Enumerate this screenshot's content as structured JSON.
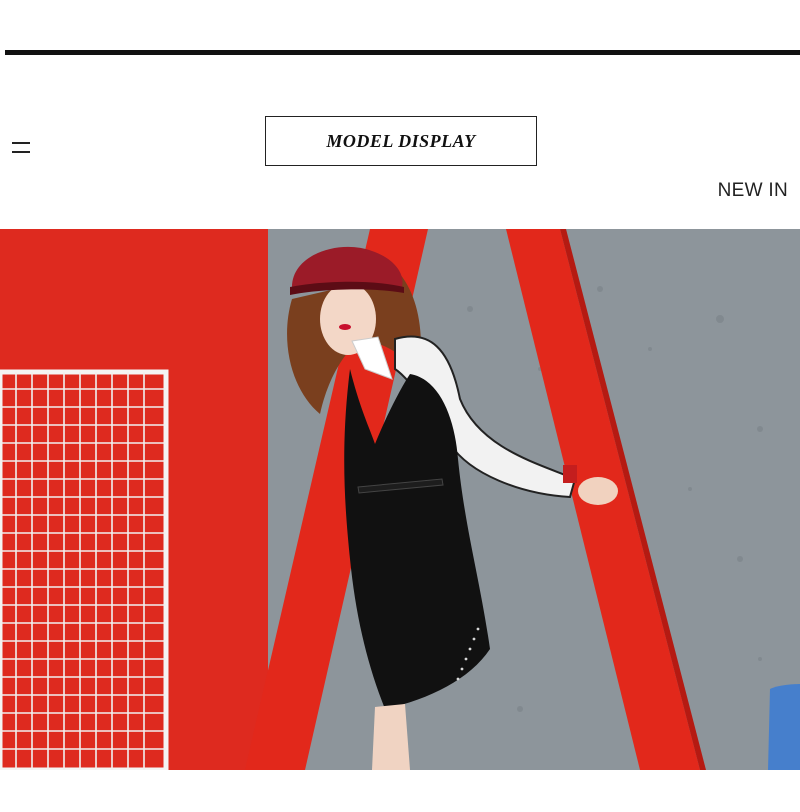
{
  "header": {
    "section_title": "MODEL DISPLAY",
    "subtitle": "NEW IN",
    "menu_icon": "menu-icon"
  },
  "photo": {
    "description_icon": "fashion-model-photo",
    "colors": {
      "red": "#e0261b",
      "gray": "#8f969c",
      "dress": "#111111",
      "shirt": "#f2f2f2",
      "hat": "#9b1b28"
    }
  }
}
